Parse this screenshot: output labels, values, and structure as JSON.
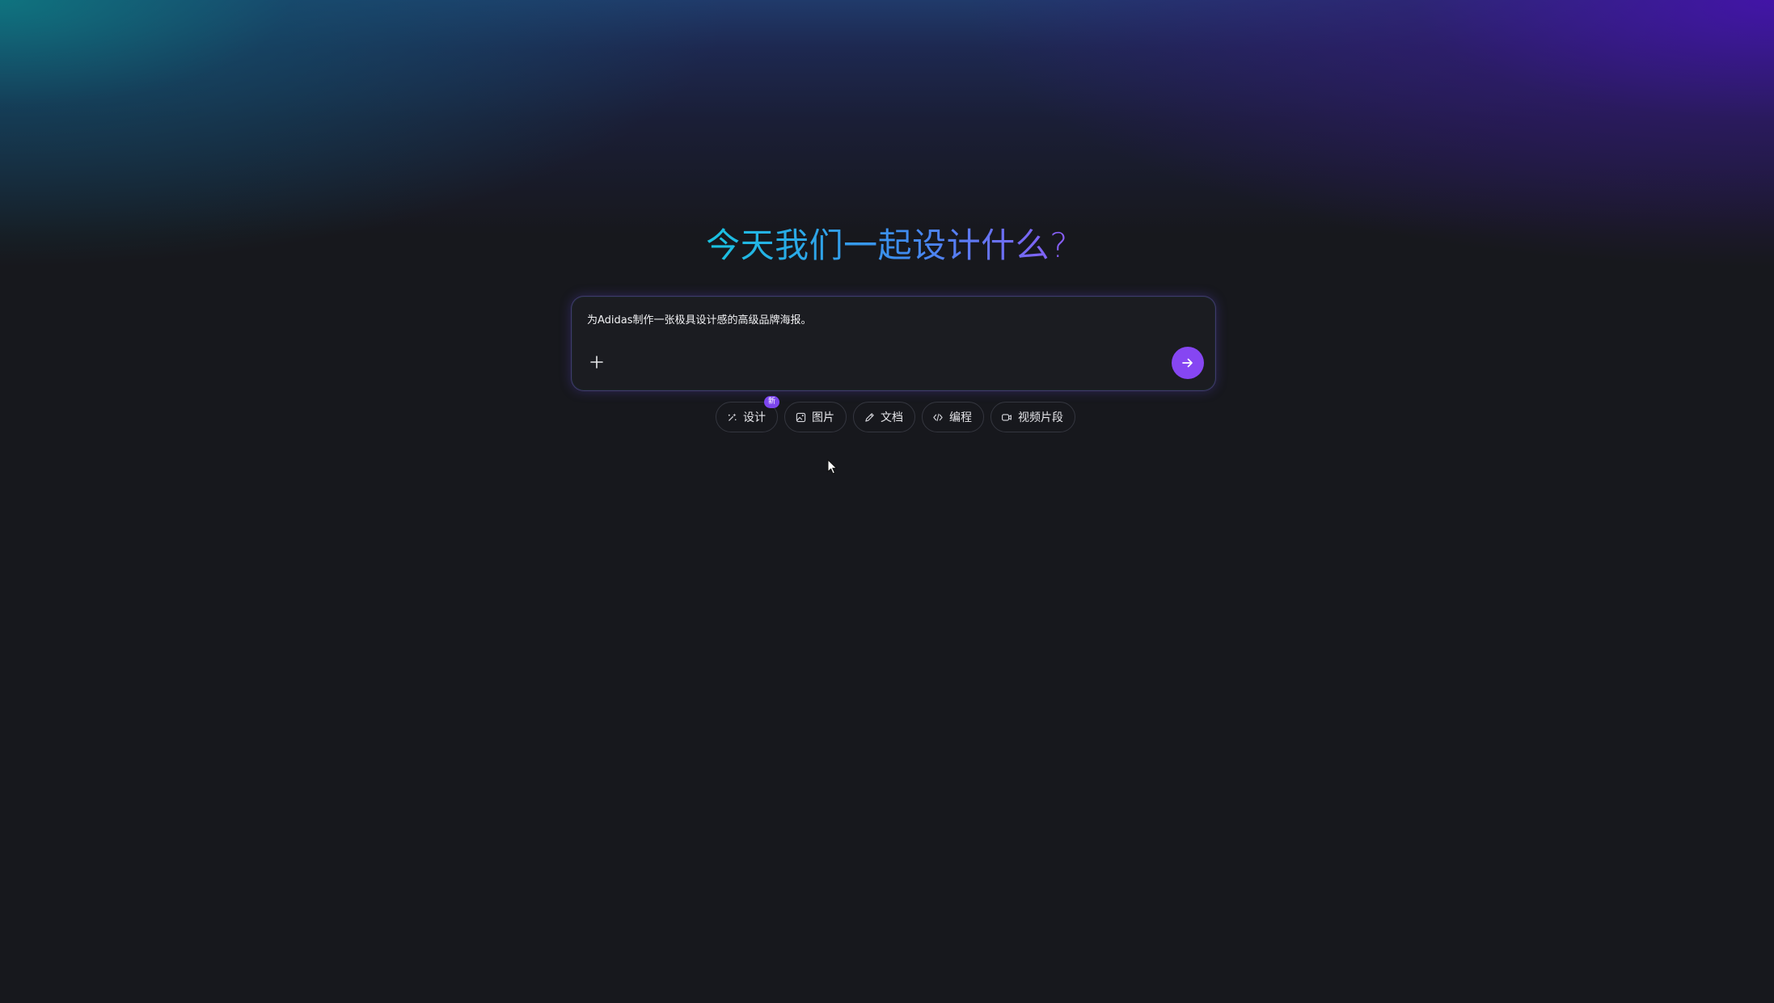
{
  "headline": "今天我们一起设计什么?",
  "prompt": {
    "value": "为Adidas制作一张极具设计感的高级品牌海报。"
  },
  "chips": [
    {
      "label": "设计",
      "icon": "sparkle-icon",
      "badge": "新"
    },
    {
      "label": "图片",
      "icon": "image-icon"
    },
    {
      "label": "文档",
      "icon": "pen-icon"
    },
    {
      "label": "编程",
      "icon": "code-icon"
    },
    {
      "label": "视频片段",
      "icon": "video-icon"
    }
  ],
  "colors": {
    "accent": "#8646f2",
    "background": "#17181d",
    "headline_start": "#19c3e0",
    "headline_end": "#8a5cf6",
    "badge": "#7c45ee"
  }
}
